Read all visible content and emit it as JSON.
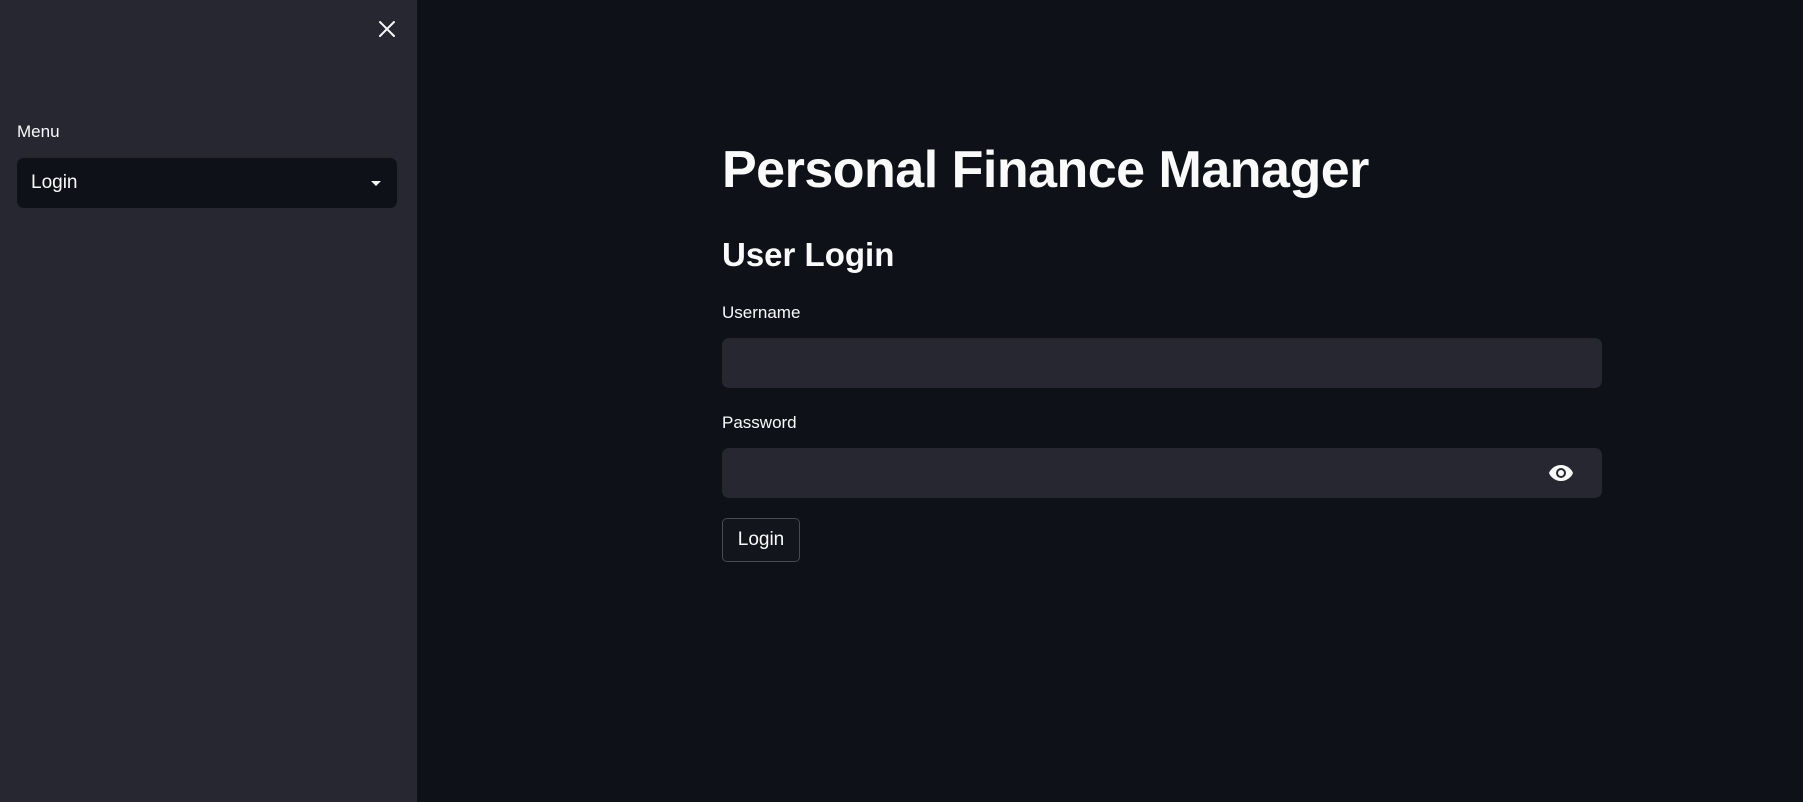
{
  "sidebar": {
    "close_icon": "close-icon",
    "menu_label": "Menu",
    "menu_select": {
      "value": "Login",
      "icon": "chevron-down-icon"
    }
  },
  "main": {
    "title": "Personal Finance Manager",
    "subtitle": "User Login",
    "username": {
      "label": "Username",
      "value": "",
      "placeholder": ""
    },
    "password": {
      "label": "Password",
      "value": "",
      "placeholder": "",
      "toggle_icon": "eye-icon"
    },
    "login_button": "Login"
  },
  "colors": {
    "background": "#0e1117",
    "sidebar_background": "#262730",
    "input_background": "#262730",
    "text": "#fafafa",
    "button_border": "#474a55"
  }
}
